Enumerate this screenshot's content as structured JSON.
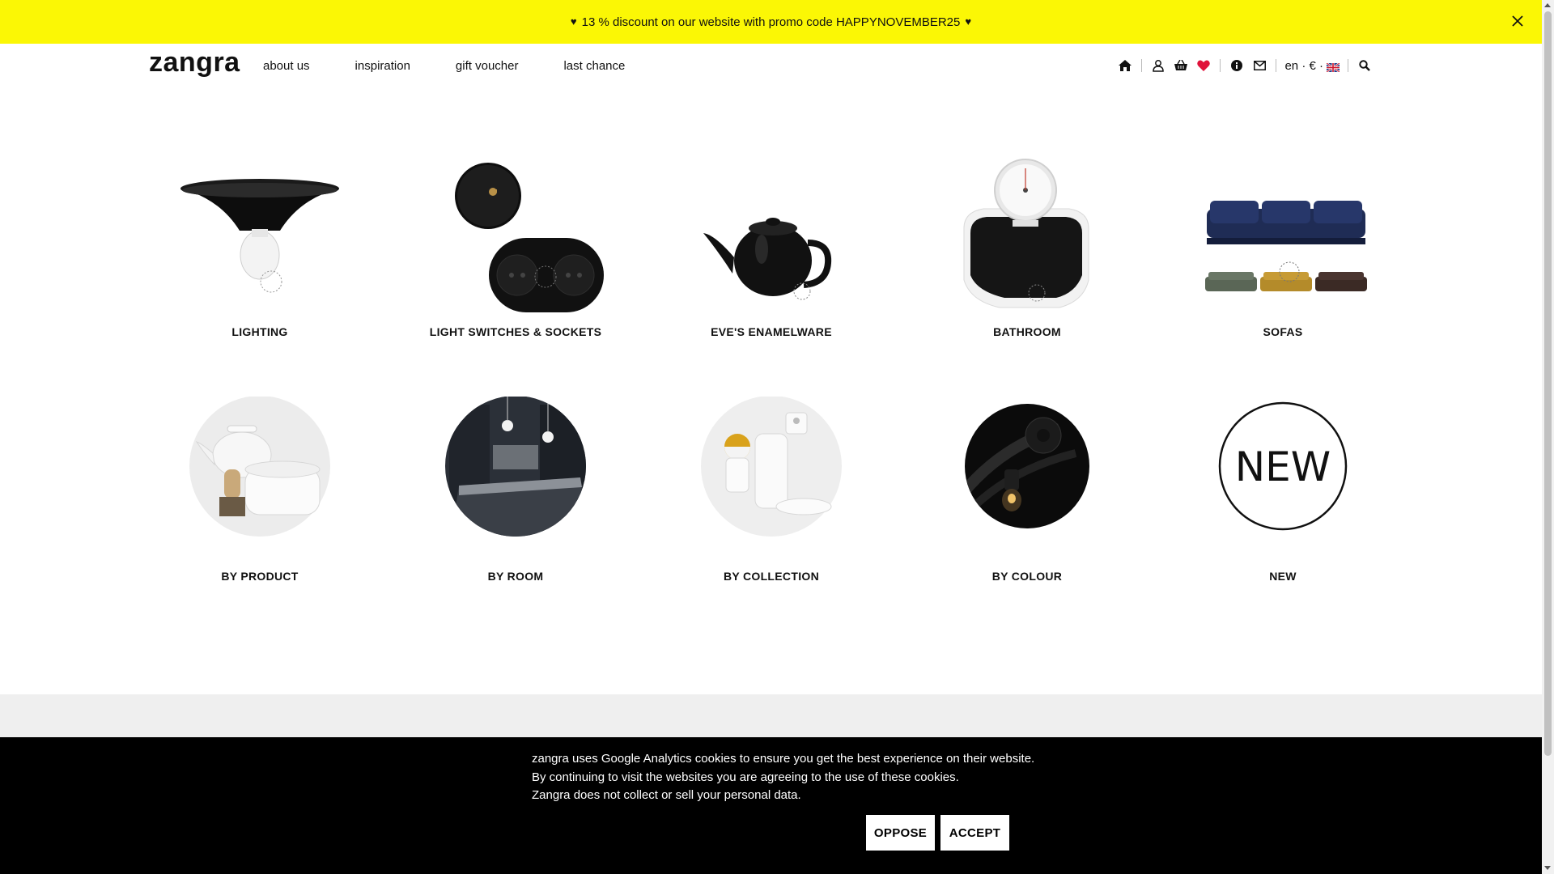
{
  "promo": {
    "text": "13 % discount on our website with promo code HAPPYNOVEMBER25",
    "heart": "♥"
  },
  "header": {
    "logo": "zangra",
    "nav": [
      "about us",
      "inspiration",
      "gift voucher",
      "last chance"
    ],
    "lang": "en · € ·",
    "icons": [
      "home-icon",
      "user-icon",
      "basket-icon",
      "heart-icon",
      "info-icon",
      "mail-icon",
      "flag-uk-icon",
      "search-icon"
    ]
  },
  "categories": [
    {
      "label": "LIGHTING"
    },
    {
      "label": "LIGHT SWITCHES & SOCKETS"
    },
    {
      "label": "EVE'S ENAMELWARE"
    },
    {
      "label": "BATHROOM"
    },
    {
      "label": "SOFAS"
    },
    {
      "label": "BY PRODUCT"
    },
    {
      "label": "BY ROOM"
    },
    {
      "label": "BY COLLECTION"
    },
    {
      "label": "BY COLOUR"
    },
    {
      "label": "NEW",
      "badge": "NEW"
    }
  ],
  "cookie": {
    "line1": "zangra uses Google Analytics cookies to ensure you get the best experience on their website.",
    "line2": "By continuing to visit the websites you are agreeing to the use of these cookies.",
    "line3": "Zangra does not collect or sell your personal data.",
    "oppose": "OPPOSE",
    "accept": "ACCEPT"
  },
  "colors": {
    "promo_bg": "#fbf705",
    "heart_red": "#e0123a",
    "cookie_bg": "#000000"
  }
}
